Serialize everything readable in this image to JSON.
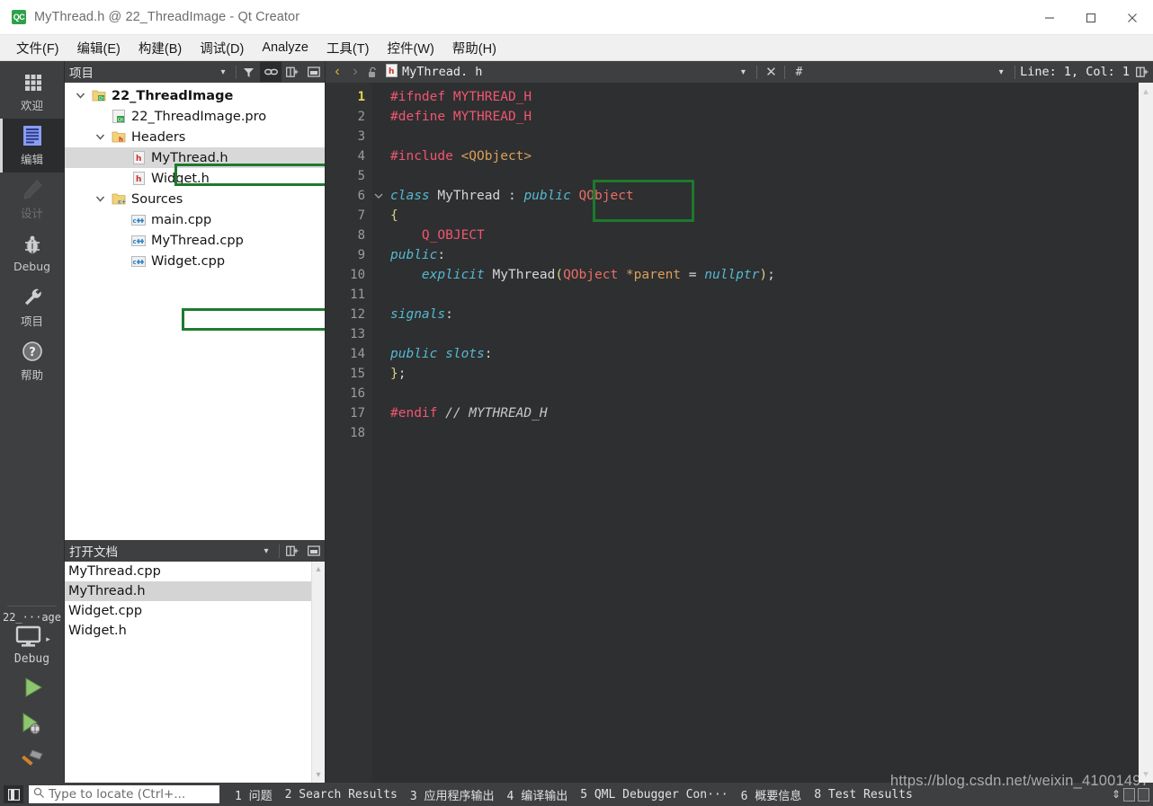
{
  "window": {
    "title": "MyThread.h @ 22_ThreadImage - Qt Creator",
    "app_icon": "qt-creator-icon",
    "minimize": "—",
    "maximize": "□",
    "close": "×"
  },
  "menubar": {
    "items": [
      {
        "label": "文件(F)",
        "name": "menu-file"
      },
      {
        "label": "编辑(E)",
        "name": "menu-edit"
      },
      {
        "label": "构建(B)",
        "name": "menu-build"
      },
      {
        "label": "调试(D)",
        "name": "menu-debug"
      },
      {
        "label": "Analyze",
        "name": "menu-analyze"
      },
      {
        "label": "工具(T)",
        "name": "menu-tools"
      },
      {
        "label": "控件(W)",
        "name": "menu-window"
      },
      {
        "label": "帮助(H)",
        "name": "menu-help"
      }
    ]
  },
  "modebar": {
    "modes": [
      {
        "label": "欢迎",
        "icon": "grid-icon",
        "state": "normal"
      },
      {
        "label": "编辑",
        "icon": "document-icon",
        "state": "active"
      },
      {
        "label": "设计",
        "icon": "pencil-icon",
        "state": "disabled"
      },
      {
        "label": "Debug",
        "icon": "bug-icon",
        "state": "normal"
      },
      {
        "label": "项目",
        "icon": "wrench-icon",
        "state": "normal"
      },
      {
        "label": "帮助",
        "icon": "question-icon",
        "state": "normal"
      }
    ],
    "kit": {
      "project": "22_···age",
      "build_config": "Debug",
      "target_icon": "desktop-icon",
      "run_label": "run-button",
      "debug_label": "start-debugging-button",
      "build_label": "build-button"
    }
  },
  "projects_panel": {
    "title": "项目",
    "toolbar": [
      {
        "name": "dropdown-chevron-icon",
        "glyph": "▾"
      },
      {
        "name": "filter-icon",
        "glyph": "filter"
      },
      {
        "name": "link-with-editor-icon",
        "glyph": "link"
      },
      {
        "name": "split-icon",
        "glyph": "split"
      },
      {
        "name": "close-panel-icon",
        "glyph": "close"
      }
    ],
    "tree": [
      {
        "label": "22_ThreadImage",
        "icon": "qt-project-icon",
        "depth": 0,
        "twist": "expanded",
        "bold": true,
        "selected": false
      },
      {
        "label": "22_ThreadImage.pro",
        "icon": "pro-file-icon",
        "depth": 1,
        "twist": "none",
        "bold": false,
        "selected": false
      },
      {
        "label": "Headers",
        "icon": "headers-folder-icon",
        "depth": 1,
        "twist": "expanded",
        "bold": false,
        "selected": false
      },
      {
        "label": "MyThread.h",
        "icon": "header-file-icon",
        "depth": 2,
        "twist": "none",
        "bold": false,
        "selected": true
      },
      {
        "label": "Widget.h",
        "icon": "header-file-icon",
        "depth": 2,
        "twist": "none",
        "bold": false,
        "selected": false
      },
      {
        "label": "Sources",
        "icon": "sources-folder-icon",
        "depth": 1,
        "twist": "expanded",
        "bold": false,
        "selected": false
      },
      {
        "label": "main.cpp",
        "icon": "cpp-file-icon",
        "depth": 2,
        "twist": "none",
        "bold": false,
        "selected": false
      },
      {
        "label": "MyThread.cpp",
        "icon": "cpp-file-icon",
        "depth": 2,
        "twist": "none",
        "bold": false,
        "selected": false
      },
      {
        "label": "Widget.cpp",
        "icon": "cpp-file-icon",
        "depth": 2,
        "twist": "none",
        "bold": false,
        "selected": false
      }
    ]
  },
  "open_documents": {
    "title": "打开文档",
    "toolbar": [
      {
        "name": "dropdown-chevron-icon",
        "glyph": "▾"
      },
      {
        "name": "split-icon",
        "glyph": "split"
      },
      {
        "name": "close-panel-icon",
        "glyph": "close"
      }
    ],
    "items": [
      {
        "label": "MyThread.cpp",
        "selected": false
      },
      {
        "label": "MyThread.h",
        "selected": true
      },
      {
        "label": "Widget.cpp",
        "selected": false
      },
      {
        "label": "Widget.h",
        "selected": false
      }
    ]
  },
  "editor": {
    "toolbar": {
      "back": "‹",
      "forward": "›",
      "lock_icon": "unlocked-icon",
      "file_icon": "header-file-icon",
      "filename": "MyThread. h",
      "dropdown": "▾",
      "close": "×",
      "symbol": "#",
      "symbol_dropdown": "▾",
      "cursor_position": "Line: 1, Col: 1",
      "split_icon": "split-editor-icon"
    },
    "current_line": 1,
    "lines": [
      {
        "n": 1,
        "fold": "",
        "tokens": [
          {
            "t": "#ifndef MYTHREAD_H",
            "c": "tok-pre"
          }
        ]
      },
      {
        "n": 2,
        "fold": "",
        "tokens": [
          {
            "t": "#define MYTHREAD_H",
            "c": "tok-pre"
          }
        ]
      },
      {
        "n": 3,
        "fold": "",
        "tokens": []
      },
      {
        "n": 4,
        "fold": "",
        "tokens": [
          {
            "t": "#include ",
            "c": "tok-pre"
          },
          {
            "t": "<QObject>",
            "c": "tok-str"
          }
        ]
      },
      {
        "n": 5,
        "fold": "",
        "tokens": []
      },
      {
        "n": 6,
        "fold": "⌄",
        "tokens": [
          {
            "t": "class ",
            "c": "tok-kw"
          },
          {
            "t": "MyThread",
            "c": "tok-plain"
          },
          {
            "t": " : ",
            "c": "tok-plain"
          },
          {
            "t": "public ",
            "c": "tok-kw"
          },
          {
            "t": "QObject",
            "c": "tok-type"
          }
        ]
      },
      {
        "n": 7,
        "fold": "",
        "tokens": [
          {
            "t": "{",
            "c": "tok-punc"
          }
        ]
      },
      {
        "n": 8,
        "fold": "",
        "tokens": [
          {
            "t": "    ",
            "c": "tok-plain"
          },
          {
            "t": "Q_OBJECT",
            "c": "tok-pre"
          }
        ]
      },
      {
        "n": 9,
        "fold": "",
        "tokens": [
          {
            "t": "public",
            "c": "tok-kw"
          },
          {
            "t": ":",
            "c": "tok-plain"
          }
        ]
      },
      {
        "n": 10,
        "fold": "",
        "tokens": [
          {
            "t": "    ",
            "c": "tok-plain"
          },
          {
            "t": "explicit ",
            "c": "tok-kw"
          },
          {
            "t": "MyThread",
            "c": "tok-plain"
          },
          {
            "t": "(",
            "c": "tok-punc"
          },
          {
            "t": "QObject ",
            "c": "tok-type"
          },
          {
            "t": "*parent",
            "c": "tok-str"
          },
          {
            "t": " = ",
            "c": "tok-plain"
          },
          {
            "t": "nullptr",
            "c": "tok-kw"
          },
          {
            "t": ")",
            "c": "tok-punc"
          },
          {
            "t": ";",
            "c": "tok-plain"
          }
        ]
      },
      {
        "n": 11,
        "fold": "",
        "tokens": []
      },
      {
        "n": 12,
        "fold": "",
        "tokens": [
          {
            "t": "signals",
            "c": "tok-kw"
          },
          {
            "t": ":",
            "c": "tok-plain"
          }
        ]
      },
      {
        "n": 13,
        "fold": "",
        "tokens": []
      },
      {
        "n": 14,
        "fold": "",
        "tokens": [
          {
            "t": "public slots",
            "c": "tok-kw"
          },
          {
            "t": ":",
            "c": "tok-plain"
          }
        ]
      },
      {
        "n": 15,
        "fold": "",
        "tokens": [
          {
            "t": "}",
            "c": "tok-punc"
          },
          {
            "t": ";",
            "c": "tok-plain"
          }
        ]
      },
      {
        "n": 16,
        "fold": "",
        "tokens": []
      },
      {
        "n": 17,
        "fold": "",
        "tokens": [
          {
            "t": "#endif ",
            "c": "tok-pre"
          },
          {
            "t": "// MYTHREAD_H",
            "c": "tok-comment"
          }
        ]
      },
      {
        "n": 18,
        "fold": "",
        "tokens": []
      }
    ]
  },
  "statusbar": {
    "sidebar_toggle": "toggle-sidebar-icon",
    "locator_placeholder": "Type to locate (Ctrl+...",
    "locator_value": "",
    "search_icon": "search-icon",
    "panes": [
      {
        "num": "1",
        "label": "问题"
      },
      {
        "num": "2",
        "label": "Search Results"
      },
      {
        "num": "3",
        "label": "应用程序输出"
      },
      {
        "num": "4",
        "label": "编译输出"
      },
      {
        "num": "5",
        "label": "QML Debugger Con···"
      },
      {
        "num": "6",
        "label": "概要信息"
      },
      {
        "num": "8",
        "label": "Test Results"
      }
    ],
    "expand_icon": "⇕"
  },
  "annotations": {
    "highlight_color": "#1d7a2e",
    "boxes": [
      {
        "target": "tree-item-mythread-h"
      },
      {
        "target": "tree-item-mythread-cpp"
      },
      {
        "target": "code-token-qobject"
      }
    ]
  },
  "watermark": {
    "text": "https://blog.csdn.net/weixin_41001497"
  }
}
